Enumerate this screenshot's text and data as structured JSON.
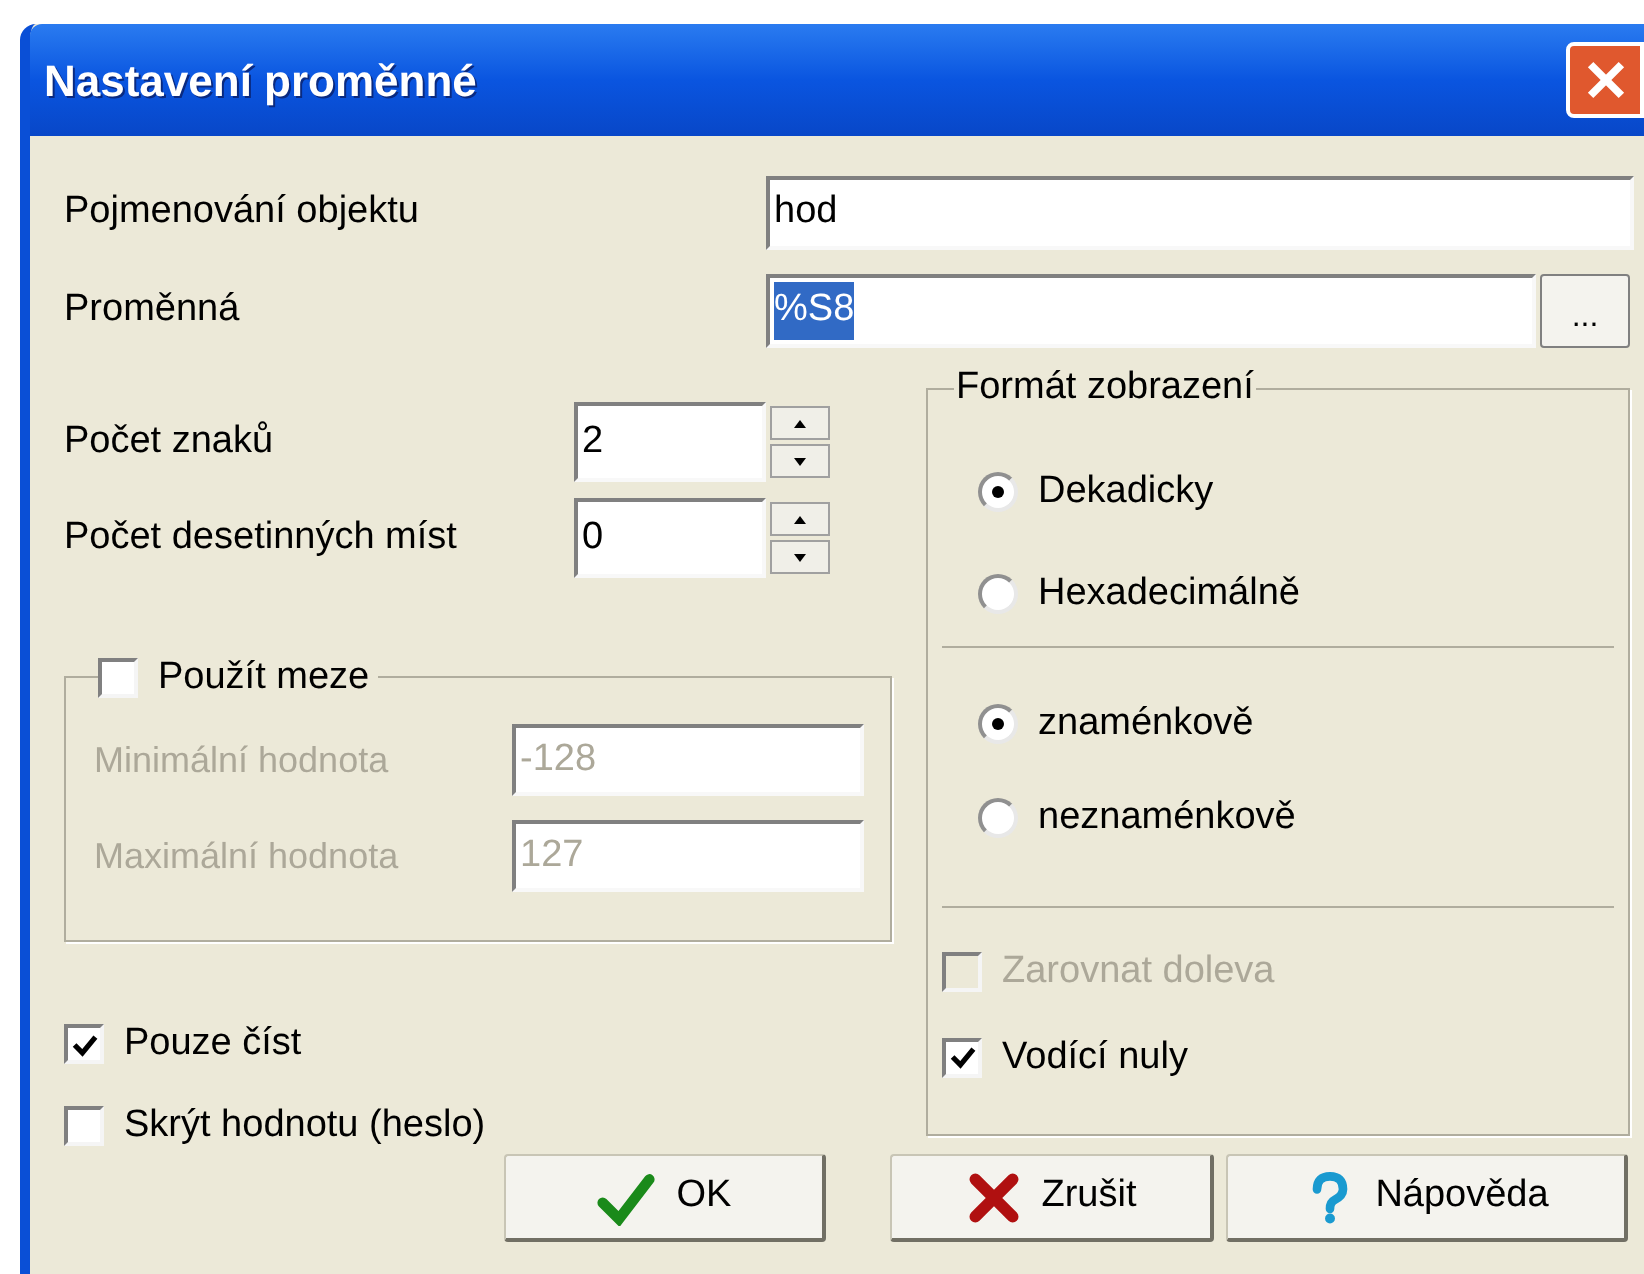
{
  "window": {
    "title": "Nastavení proměnné"
  },
  "fields": [
    {
      "label": "Pojmenování objektu",
      "value": "hod",
      "selected": false
    },
    {
      "label": "Proměnná",
      "value": "%S8",
      "selected": true,
      "browse_button": "..."
    }
  ],
  "spinners": [
    {
      "label": "Počet znaků",
      "value": "2"
    },
    {
      "label": "Počet desetinných míst",
      "value": "0"
    }
  ],
  "limits": {
    "label": "Použít meze",
    "checked": false,
    "fields": [
      {
        "label": "Minimální hodnota",
        "value": "-128",
        "disabled": true
      },
      {
        "label": "Maximální hodnota",
        "value": "127",
        "disabled": true
      }
    ]
  },
  "options": [
    {
      "label": "Pouze číst",
      "checked": true
    },
    {
      "label": "Skrýt hodnotu (heslo)",
      "checked": false
    }
  ],
  "display_format": {
    "title": "Formát zobrazení",
    "radio_groups": [
      [
        {
          "label": "Dekadicky",
          "selected": true
        },
        {
          "label": "Hexadecimálně",
          "selected": false
        }
      ],
      [
        {
          "label": "znaménkově",
          "selected": true
        },
        {
          "label": "neznaménkově",
          "selected": false
        }
      ]
    ],
    "checkboxes": [
      {
        "label": "Zarovnat doleva",
        "checked": false,
        "disabled": true
      },
      {
        "label": "Vodící nuly",
        "checked": true,
        "disabled": false
      }
    ]
  },
  "buttons": [
    {
      "label": "OK",
      "kind": "ok"
    },
    {
      "label": "Zrušit",
      "kind": "cancel"
    },
    {
      "label": "Nápověda",
      "kind": "help"
    }
  ]
}
